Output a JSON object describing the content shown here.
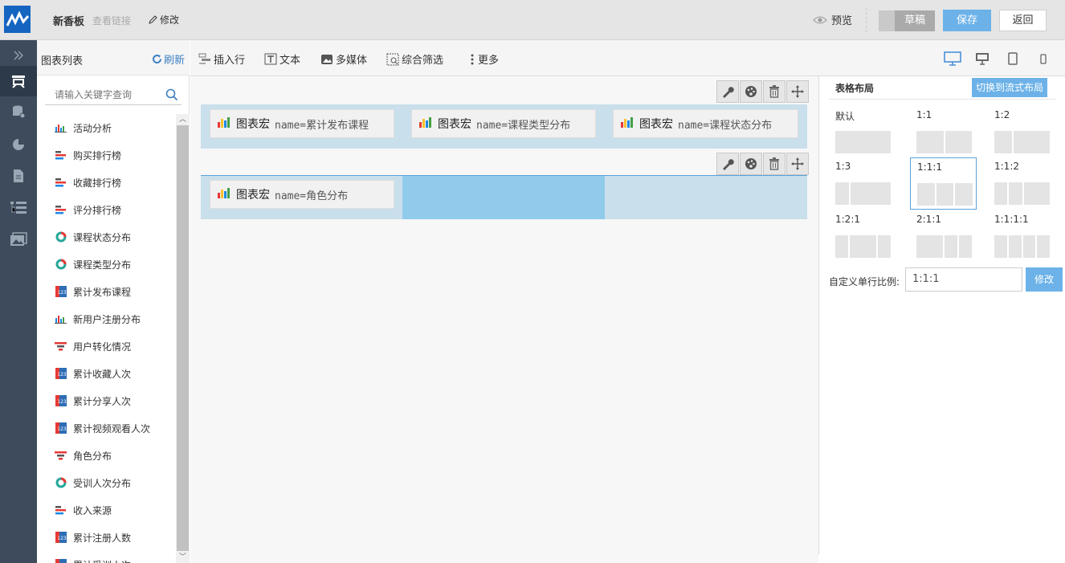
{
  "header": {
    "title": "新香板",
    "view_link": "查看链接",
    "edit_link": "修改",
    "preview": "预览",
    "draft": "草稿",
    "save": "保存",
    "back": "返回"
  },
  "nav_icons": [
    "expand-icon",
    "dashboard-icon",
    "database-icon",
    "pie-chart-icon",
    "document-icon",
    "tree-list-icon",
    "image-icon"
  ],
  "chart_list": {
    "title": "图表列表",
    "refresh": "刷新",
    "search_placeholder": "请输入关键字查询",
    "items": [
      {
        "label": "活动分析",
        "icon": "bar"
      },
      {
        "label": "购买排行榜",
        "icon": "hbar"
      },
      {
        "label": "收藏排行榜",
        "icon": "hbar"
      },
      {
        "label": "评分排行榜",
        "icon": "hbar"
      },
      {
        "label": "课程状态分布",
        "icon": "donut"
      },
      {
        "label": "课程类型分布",
        "icon": "donut"
      },
      {
        "label": "累计发布课程",
        "icon": "kpi"
      },
      {
        "label": "新用户注册分布",
        "icon": "bar"
      },
      {
        "label": "用户转化情况",
        "icon": "funnel"
      },
      {
        "label": "累计收藏人次",
        "icon": "kpi"
      },
      {
        "label": "累计分享人次",
        "icon": "kpi"
      },
      {
        "label": "累计视频观看人次",
        "icon": "kpi"
      },
      {
        "label": "角色分布",
        "icon": "funnel"
      },
      {
        "label": "受训人次分布",
        "icon": "donut"
      },
      {
        "label": "收入来源",
        "icon": "hbar"
      },
      {
        "label": "累计注册人数",
        "icon": "kpi"
      },
      {
        "label": "累计受训人次",
        "icon": "kpi"
      }
    ]
  },
  "toolbar": {
    "insert_row": "插入行",
    "text": "文本",
    "media": "多媒体",
    "filter": "综合筛选",
    "more": "更多"
  },
  "canvas": {
    "row1": [
      {
        "label": "图表宏",
        "name": "name=累计发布课程"
      },
      {
        "label": "图表宏",
        "name": "name=课程类型分布"
      },
      {
        "label": "图表宏",
        "name": "name=课程状态分布"
      }
    ],
    "row2": [
      {
        "label": "图表宏",
        "name": "name=角色分布"
      }
    ]
  },
  "layout_panel": {
    "title": "表格布局",
    "switch_button": "切换到流式布局",
    "options": [
      {
        "label": "默认",
        "ratio": [
          1
        ],
        "selected": false
      },
      {
        "label": "1:1",
        "ratio": [
          1,
          1
        ],
        "selected": false
      },
      {
        "label": "1:2",
        "ratio": [
          1,
          2
        ],
        "selected": false
      },
      {
        "label": "1:3",
        "ratio": [
          1,
          3
        ],
        "selected": false
      },
      {
        "label": "1:1:1",
        "ratio": [
          1,
          1,
          1
        ],
        "selected": true
      },
      {
        "label": "1:1:2",
        "ratio": [
          1,
          1,
          2
        ],
        "selected": false
      },
      {
        "label": "1:2:1",
        "ratio": [
          1,
          2,
          1
        ],
        "selected": false
      },
      {
        "label": "2:1:1",
        "ratio": [
          2,
          1,
          1
        ],
        "selected": false
      },
      {
        "label": "1:1:1:1",
        "ratio": [
          1,
          1,
          1,
          1
        ],
        "selected": false
      }
    ],
    "custom_label": "自定义单行比例:",
    "custom_value": "1:1:1",
    "custom_button": "修改"
  },
  "colors": {
    "accent": "#6cb2e8",
    "nav_bg": "#3d4b5c",
    "row_bg": "#c9dfeb",
    "row_highlight": "#91cbeb"
  }
}
